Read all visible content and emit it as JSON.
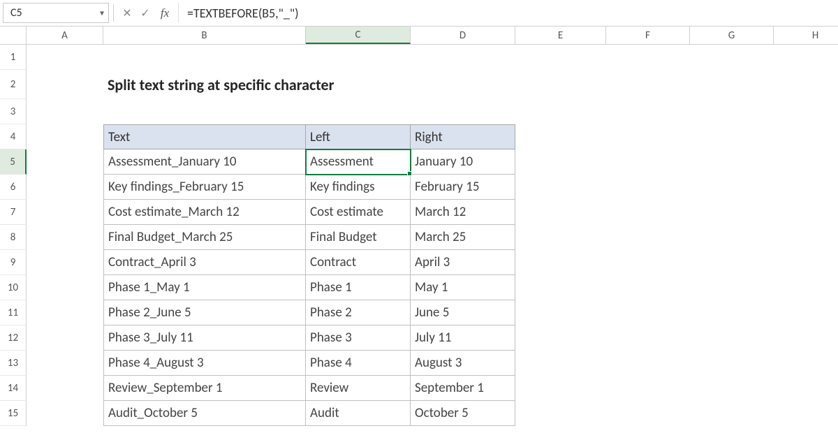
{
  "namebox": {
    "value": "C5"
  },
  "formula_bar": {
    "fx_label": "fx",
    "formula": "=TEXTBEFORE(B5,\"_\")"
  },
  "columns": [
    "",
    "A",
    "B",
    "C",
    "D",
    "E",
    "F",
    "G",
    "H"
  ],
  "active_column": "C",
  "active_row": 5,
  "row_numbers": [
    1,
    2,
    3,
    4,
    5,
    6,
    7,
    8,
    9,
    10,
    11,
    12,
    13,
    14,
    15
  ],
  "title": "Split text string at specific character",
  "headers": {
    "text": "Text",
    "left": "Left",
    "right": "Right"
  },
  "table": [
    {
      "text": "Assessment_January 10",
      "left": "Assessment",
      "right": "January 10"
    },
    {
      "text": "Key findings_February 15",
      "left": "Key findings",
      "right": "February 15"
    },
    {
      "text": "Cost estimate_March 12",
      "left": "Cost estimate",
      "right": "March 12"
    },
    {
      "text": "Final Budget_March 25",
      "left": "Final Budget",
      "right": "March 25"
    },
    {
      "text": "Contract_April 3",
      "left": "Contract",
      "right": "April 3"
    },
    {
      "text": "Phase 1_May 1",
      "left": "Phase 1",
      "right": "May 1"
    },
    {
      "text": "Phase 2_June 5",
      "left": "Phase 2",
      "right": "June 5"
    },
    {
      "text": "Phase 3_July 11",
      "left": "Phase 3",
      "right": "July 11"
    },
    {
      "text": "Phase 4_August 3",
      "left": "Phase 4",
      "right": "August 3"
    },
    {
      "text": "Review_September 1",
      "left": "Review",
      "right": "September 1"
    },
    {
      "text": "Audit_October 5",
      "left": "Audit",
      "right": "October 5"
    }
  ]
}
